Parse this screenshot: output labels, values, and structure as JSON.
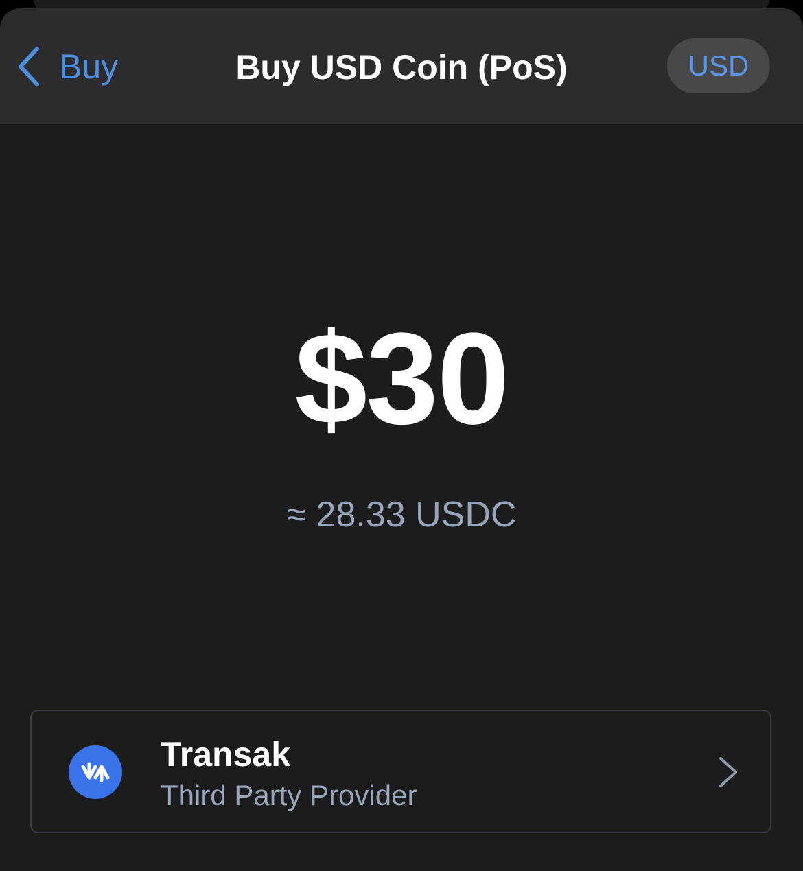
{
  "nav": {
    "back_label": "Buy",
    "title": "Buy USD Coin (PoS)",
    "currency_button": "USD"
  },
  "purchase": {
    "amount": "$30",
    "conversion": "≈ 28.33 USDC"
  },
  "provider": {
    "name": "Transak",
    "description": "Third Party Provider",
    "icon": "transak-swap-icon"
  },
  "colors": {
    "accent": "#4e8fe0",
    "background": "#1c1c1d",
    "navbar": "#2c2c2e",
    "secondary_text": "#98a6bd",
    "provider_logo": "#3b74ea"
  }
}
